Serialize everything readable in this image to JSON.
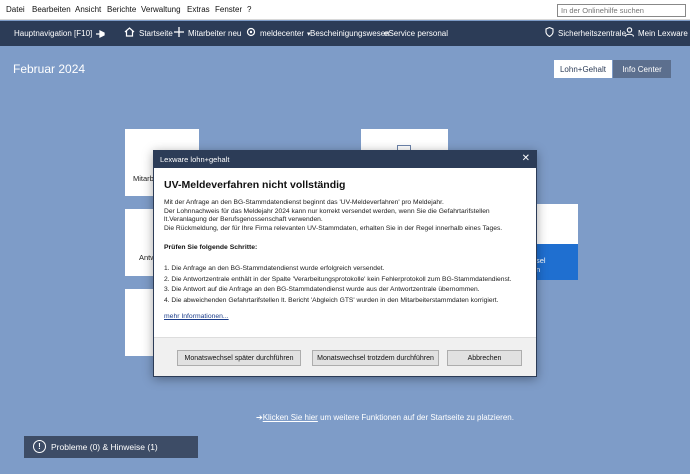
{
  "menubar": {
    "items": [
      "Datei",
      "Bearbeiten",
      "Ansicht",
      "Berichte",
      "Verwaltung",
      "Extras",
      "Fenster",
      "?"
    ],
    "search_placeholder": "In der Onlinehilfe suchen"
  },
  "navbar": {
    "hauptnavigation": "Hauptnavigation [F10]",
    "startseite": "Startseite",
    "mitarbeiter_neu": "Mitarbeiter neu",
    "meldecenter": "meldecenter",
    "bescheinigungswesen": "Bescheinigungswesen",
    "eservice": "eService personal",
    "sicherheitszentrale": "Sicherheitszentrale",
    "mein_lexware": "Mein Lexware"
  },
  "header": {
    "title": "Februar 2024",
    "tabs": [
      {
        "label": "Lohn+Gehalt",
        "active": true
      },
      {
        "label": "Info Center",
        "active": false
      }
    ]
  },
  "tiles": {
    "tile1_text": "Mitarb",
    "tile2_text": "Antw",
    "tile3_text": "sel",
    "tile3_text2": "n"
  },
  "bottom": {
    "hint_link": "Klicken Sie hier",
    "hint_rest": " um weitere Funktionen auf der Startseite zu platzieren.",
    "probleme": "Probleme (0) & Hinweise (1)"
  },
  "dialog": {
    "title": "Lexware lohn+gehalt",
    "heading": "UV-Meldeverfahren nicht vollständig",
    "body_lines": [
      "Mit der Anfrage an den BG-Stammdatendienst beginnt das 'UV-Meldeverfahren' pro Meldejahr.",
      "Der Lohnnachweis für das Meldejahr 2024 kann nur korrekt versendet werden, wenn Sie die Gefahrtarifstellen lt.Veranlagung der Berufsgenossenschaft verwenden.",
      "Die Rückmeldung, der für Ihre Firma relevanten UV-Stammdaten, erhalten Sie in der Regel innerhalb eines Tages."
    ],
    "steps_title": "Prüfen Sie folgende Schritte:",
    "steps": [
      "1. Die Anfrage an den BG-Stammdatendienst wurde erfolgreich versendet.",
      "2. Die Antwortzentrale enthält in der Spalte 'Verarbeitungsprotokolle' kein Fehlerprotokoll zum BG-Stammdatendienst.",
      "3. Die Antwort auf die Anfrage an den BG-Stammdatendienst wurde aus der Antwortzentrale übernommen.",
      "4. Die abweichenden Gefahrtarifstellen lt. Bericht 'Abgleich GTS' wurden in den Mitarbeiterstammdaten korrigiert."
    ],
    "more_link": "mehr Informationen...",
    "buttons": {
      "later": "Monatswechsel später durchführen",
      "anyway": "Monatswechsel trotzdem durchführen",
      "cancel": "Abbrechen"
    }
  },
  "colors": {
    "background": "#7e9cc8",
    "navbar": "#2c3c57",
    "accent_blue": "#1f6fd0"
  }
}
